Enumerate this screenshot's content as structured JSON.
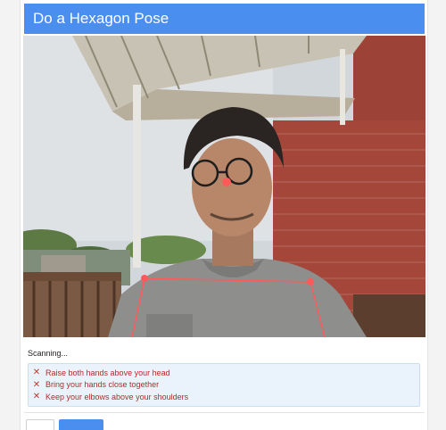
{
  "dialog": {
    "title": "Do a Hexagon Pose"
  },
  "camera": {
    "status": "Scanning..."
  },
  "instructions": {
    "icon": "x-icon",
    "color": "#b52a2a",
    "items": [
      "Raise both hands above your head",
      "Bring your hands close together",
      "Keep your elbows above your shoulders"
    ]
  },
  "footer": {
    "secondary_label": "",
    "primary_label": ""
  },
  "colors": {
    "accent": "#4a8ef0",
    "pose_line": "#ff5a5a",
    "error": "#c0392b"
  }
}
